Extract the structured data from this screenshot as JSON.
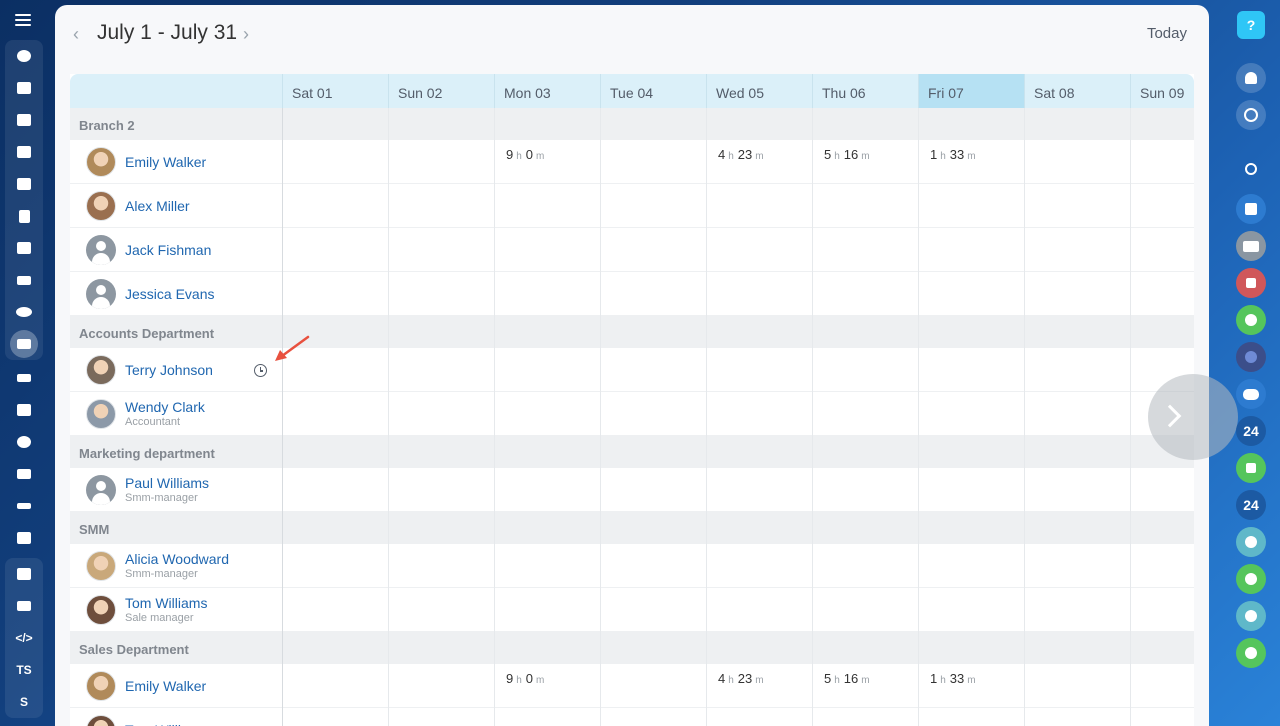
{
  "header": {
    "prev_arrow": "‹",
    "next_arrow": "›",
    "period": "July 1 - July 31",
    "today": "Today"
  },
  "days": [
    {
      "label": "Sat 01"
    },
    {
      "label": "Sun 02"
    },
    {
      "label": "Mon 03"
    },
    {
      "label": "Tue 04"
    },
    {
      "label": "Wed 05"
    },
    {
      "label": "Thu 06"
    },
    {
      "label": "Fri 07",
      "current": true
    },
    {
      "label": "Sat 08"
    },
    {
      "label": "Sun 09"
    }
  ],
  "groups": [
    {
      "name": "Branch 2"
    },
    {
      "name": "Accounts Department"
    },
    {
      "name": "Marketing department"
    },
    {
      "name": "SMM"
    },
    {
      "name": "Sales Department"
    }
  ],
  "people": [
    {
      "name": "Emily Walker",
      "role": "",
      "avatar": "photo",
      "color": "#b08a5a"
    },
    {
      "name": "Alex Miller",
      "role": "",
      "avatar": "photo",
      "color": "#9a6f4f"
    },
    {
      "name": "Jack Fishman",
      "role": "",
      "avatar": "default"
    },
    {
      "name": "Jessica Evans",
      "role": "",
      "avatar": "default"
    },
    {
      "name": "Terry Johnson",
      "role": "",
      "avatar": "photo",
      "color": "#7a6a5c"
    },
    {
      "name": "Wendy Clark",
      "role": "Accountant",
      "avatar": "photo",
      "color": "#8c99a8"
    },
    {
      "name": "Paul Williams",
      "role": "Smm-manager",
      "avatar": "default"
    },
    {
      "name": "Alicia Woodward",
      "role": "Smm-manager",
      "avatar": "photo",
      "color": "#c9a87a"
    },
    {
      "name": "Tom Williams",
      "role": "Sale manager",
      "avatar": "photo",
      "color": "#6e4e3c"
    },
    {
      "name": "Emily Walker",
      "role": "",
      "avatar": "photo",
      "color": "#b08a5a"
    },
    {
      "name": "Tom Williams",
      "role": "",
      "avatar": "photo",
      "color": "#6e4e3c"
    }
  ],
  "times": {
    "unit_h": "h",
    "unit_m": "m",
    "row1": [
      {
        "day": "Mon 03",
        "h": "9",
        "m": "0"
      },
      {
        "day": "Wed 05",
        "h": "4",
        "m": "23"
      },
      {
        "day": "Thu 06",
        "h": "5",
        "m": "16"
      },
      {
        "day": "Fri 07",
        "h": "1",
        "m": "33"
      }
    ],
    "row_sales": [
      {
        "day": "Mon 03",
        "h": "9",
        "m": "0"
      },
      {
        "day": "Wed 05",
        "h": "4",
        "m": "23"
      },
      {
        "day": "Thu 06",
        "h": "5",
        "m": "16"
      },
      {
        "day": "Fri 07",
        "h": "1",
        "m": "33"
      }
    ]
  },
  "left_nav": {
    "initials_1": "TS",
    "initials_2": "S"
  },
  "right_nav": {
    "help": "?",
    "badge_24": "24"
  },
  "colors": {
    "accent": "#2067b0",
    "header_bg": "#dbf0f9",
    "current_day_bg": "#b6e1f3",
    "help_bg": "#2fc6f6",
    "green": "#55c55c",
    "red": "#d0575a"
  }
}
